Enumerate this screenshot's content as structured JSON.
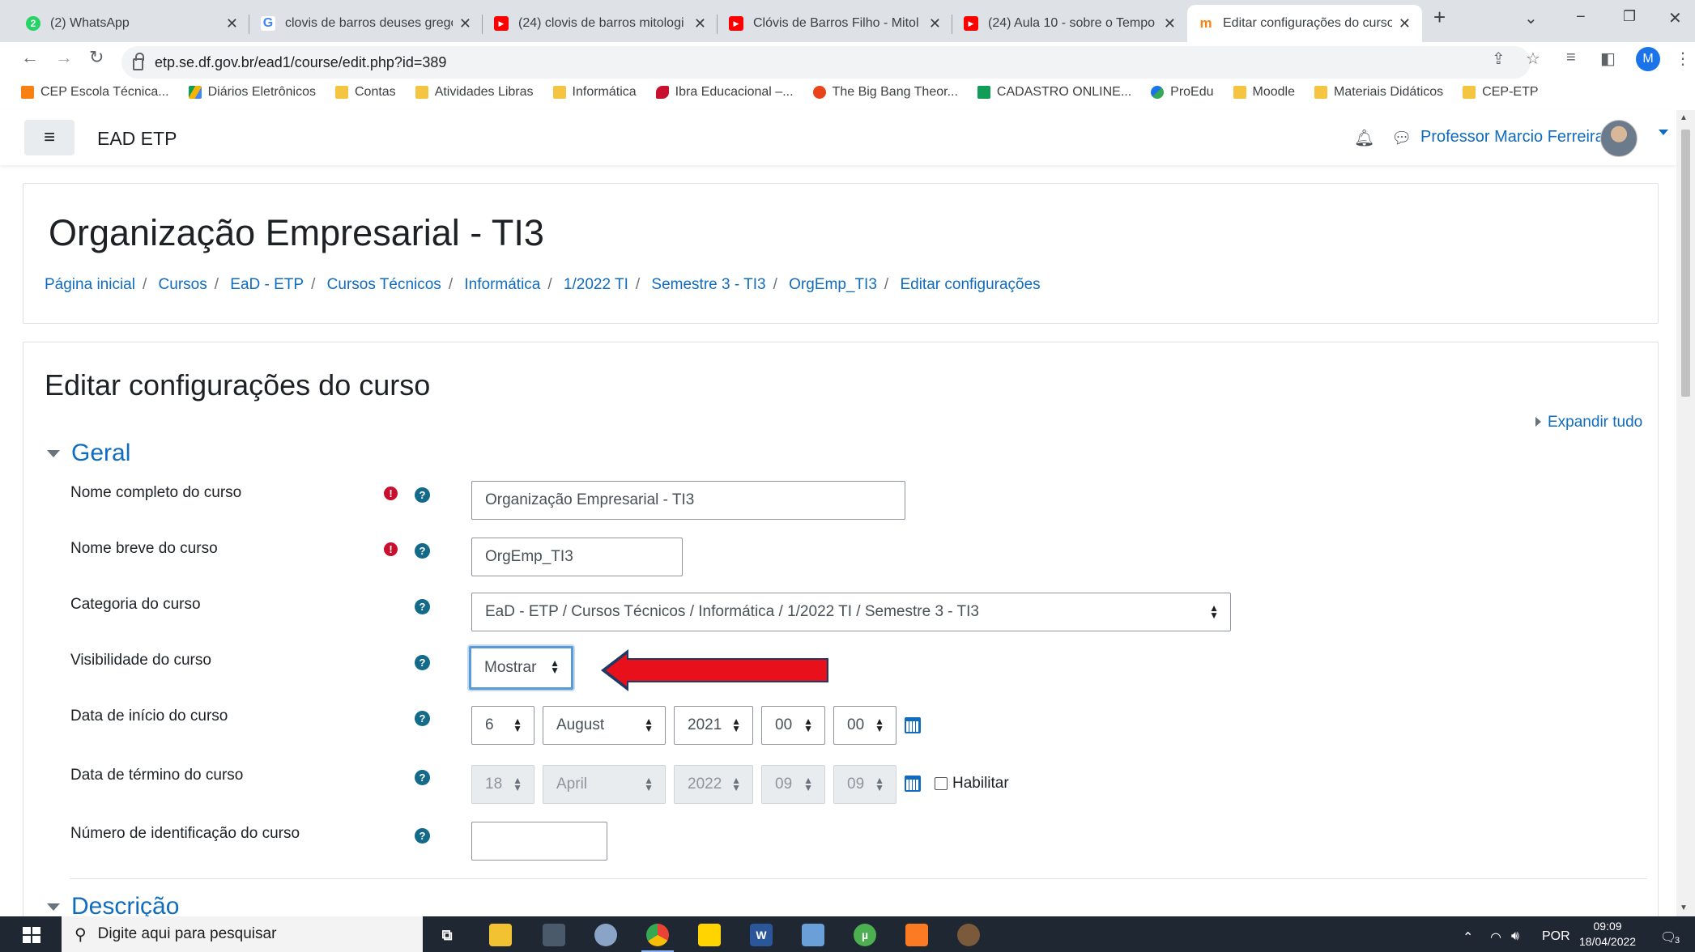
{
  "browser": {
    "tabs": [
      {
        "title": "(2) WhatsApp",
        "icon": "whatsapp-icon",
        "badge": "2",
        "color": "#25d366"
      },
      {
        "title": "clovis de barros deuses grego",
        "icon": "google-icon",
        "badge": "G",
        "color": "#4285f4"
      },
      {
        "title": "(24) clovis de barros mitologi",
        "icon": "youtube-icon",
        "badge": "▶",
        "color": "#ff0000"
      },
      {
        "title": "Clóvis de Barros Filho - Mitol",
        "icon": "youtube-icon",
        "badge": "▶",
        "color": "#ff0000"
      },
      {
        "title": "(24) Aula 10 - sobre o Tempo",
        "icon": "youtube-icon",
        "badge": "▶",
        "color": "#ff0000"
      },
      {
        "title": "Editar configurações do curso",
        "icon": "moodle-icon",
        "badge": "m",
        "color": "#f98012"
      }
    ],
    "new_tab_symbol": "+",
    "url": "etp.se.df.gov.br/ead1/course/edit.php?id=389",
    "profile_initial": "M",
    "bookmarks": [
      {
        "label": "CEP Escola Técnica...",
        "icon": "moodle-icon"
      },
      {
        "label": "Diários Eletrônicos",
        "icon": "drive-icon"
      },
      {
        "label": "Contas",
        "icon": "folder-icon"
      },
      {
        "label": "Atividades Libras",
        "icon": "folder-icon"
      },
      {
        "label": "Informática",
        "icon": "folder-icon"
      },
      {
        "label": "Ibra Educacional –...",
        "icon": "ibra-icon"
      },
      {
        "label": "The Big Bang Theor...",
        "icon": "bigbang-icon"
      },
      {
        "label": "CADASTRO ONLINE...",
        "icon": "sheets-icon"
      },
      {
        "label": "ProEdu",
        "icon": "proedu-icon"
      },
      {
        "label": "Moodle",
        "icon": "folder-icon"
      },
      {
        "label": "Materiais Didáticos",
        "icon": "folder-icon"
      },
      {
        "label": "CEP-ETP",
        "icon": "folder-icon"
      }
    ]
  },
  "navbar": {
    "brand": "EAD ETP",
    "user_name": "Professor Marcio Ferreira"
  },
  "header": {
    "course_title": "Organização Empresarial - TI3",
    "breadcrumbs": [
      "Página inicial",
      "Cursos",
      "EaD - ETP",
      "Cursos Técnicos",
      "Informática",
      "1/2022 TI",
      "Semestre 3 - TI3",
      "OrgEmp_TI3",
      "Editar configurações"
    ],
    "breadcrumb_separator": "/"
  },
  "form": {
    "title": "Editar configurações do curso",
    "expand_all": "Expandir tudo",
    "section_general": "Geral",
    "section_description": "Descrição",
    "fields": {
      "fullname": {
        "label": "Nome completo do curso",
        "value": "Organização Empresarial - TI3"
      },
      "shortname": {
        "label": "Nome breve do curso",
        "value": "OrgEmp_TI3"
      },
      "category": {
        "label": "Categoria do curso",
        "value": "EaD - ETP / Cursos Técnicos / Informática / 1/2022 TI / Semestre 3 - TI3"
      },
      "visibility": {
        "label": "Visibilidade do curso",
        "value": "Mostrar"
      },
      "startdate": {
        "label": "Data de início do curso",
        "day": "6",
        "month": "August",
        "year": "2021",
        "hour": "00",
        "minute": "00"
      },
      "enddate": {
        "label": "Data de término do curso",
        "day": "18",
        "month": "April",
        "year": "2022",
        "hour": "09",
        "minute": "09",
        "enable_label": "Habilitar",
        "enabled": false
      },
      "idnumber": {
        "label": "Número de identificação do curso",
        "value": ""
      }
    },
    "required_symbol": "!",
    "help_symbol": "?"
  },
  "annotation": {
    "arrow_color": "#e8101a",
    "arrow_outline": "#1f3864"
  },
  "taskbar": {
    "search_placeholder": "Digite aqui para pesquisar",
    "language": "POR",
    "time": "09:09",
    "date": "18/04/2022",
    "notification_count": "3"
  }
}
